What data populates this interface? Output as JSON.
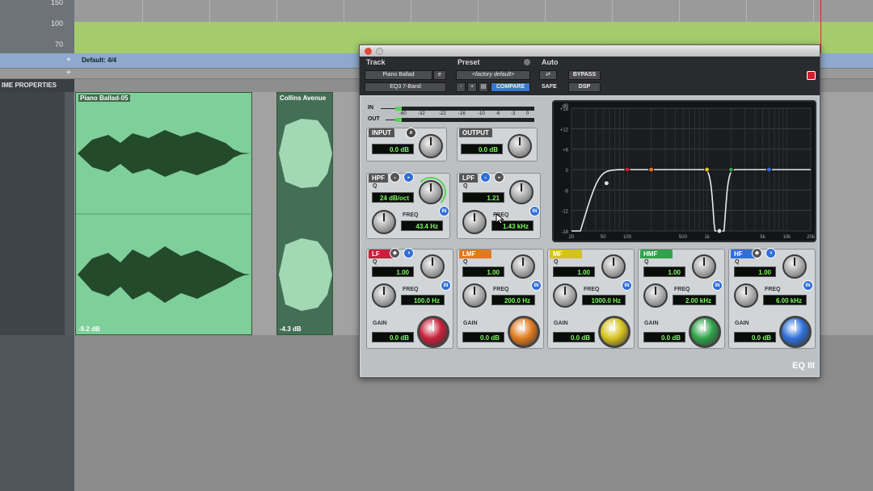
{
  "ruler": {
    "labels": [
      "150",
      "100",
      "70"
    ]
  },
  "timeline": {
    "meter": "Default: 4/4",
    "properties_label": "IME PROPERTIES"
  },
  "clips": [
    {
      "name": "Piano Ballad-05",
      "gain": "-9.2 dB"
    },
    {
      "name": "Collins Avenue",
      "gain": "-4.3 dB"
    }
  ],
  "plugin": {
    "track_label": "Track",
    "track_name": "Piano Ballad",
    "track_channel": "e",
    "plugin_name": "EQ3 7-Band",
    "preset_label": "Preset",
    "preset_name": "<factory default>",
    "preset_minus": "-",
    "preset_plus": "+",
    "compare": "COMPARE",
    "auto_label": "Auto",
    "safe": "SAFE",
    "bypass": "BYPASS",
    "dsp": "DSP",
    "meter_in": "IN",
    "meter_out": "OUT",
    "meter_ticks": [
      "-60",
      "-32",
      "-22",
      "-16",
      "-10",
      "-6",
      "-3",
      "0"
    ],
    "input": {
      "label": "INPUT",
      "value": "0.0 dB"
    },
    "output": {
      "label": "OUTPUT",
      "value": "0.0 dB"
    },
    "hpf": {
      "label": "HPF",
      "q_label": "Q",
      "q_value": "24 dB/oct",
      "freq_label": "FREQ",
      "freq_value": "43.4 Hz"
    },
    "lpf": {
      "label": "LPF",
      "q_label": "Q",
      "q_value": "1.21",
      "freq_label": "FREQ",
      "freq_value": "1.43 kHz"
    },
    "in_label": "IN",
    "bands": [
      {
        "label": "LF",
        "q": "1.00",
        "freq": "100.0 Hz",
        "gain": "0.0 dB",
        "color": "#c8203a"
      },
      {
        "label": "LMF",
        "q": "1.00",
        "freq": "200.0 Hz",
        "gain": "0.0 dB",
        "color": "#e07a1e"
      },
      {
        "label": "MF",
        "q": "1.00",
        "freq": "1000.0 Hz",
        "gain": "0.0 dB",
        "color": "#d6c21e"
      },
      {
        "label": "HMF",
        "q": "1.00",
        "freq": "2.00 kHz",
        "gain": "0.0 dB",
        "color": "#2fa24a"
      },
      {
        "label": "HF",
        "q": "1.00",
        "freq": "6.00 kHz",
        "gain": "0.0 dB",
        "color": "#2f6fd8"
      }
    ],
    "band_q_label": "Q",
    "band_freq_label": "FREQ",
    "band_gain_label": "GAIN",
    "graph": {
      "y_ticks": [
        "+18",
        "+12",
        "+6",
        "0",
        "-6",
        "-12",
        "-18"
      ],
      "top_tick": "dB",
      "x_ticks": [
        "20",
        "50",
        "100",
        "500",
        "1k",
        "5k",
        "10k",
        "20k"
      ]
    },
    "logo": "EQ III"
  }
}
